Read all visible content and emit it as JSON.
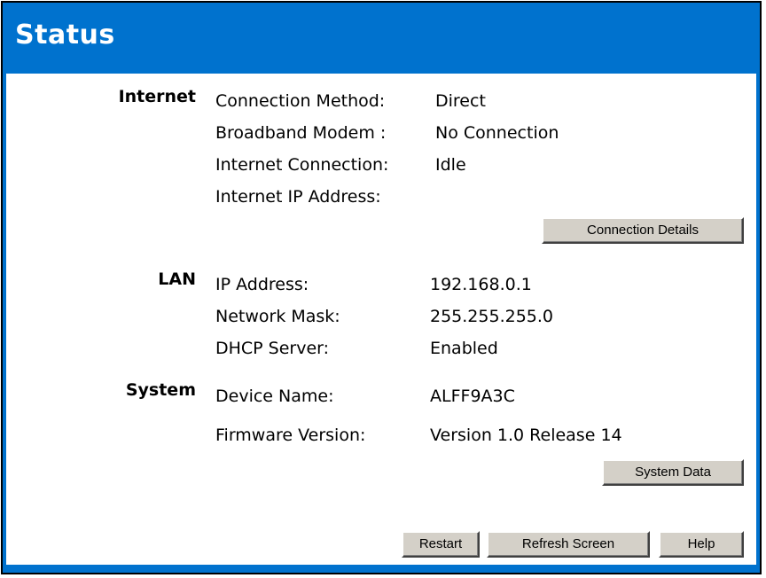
{
  "header": {
    "title": "Status"
  },
  "internet": {
    "title": "Internet",
    "rows": [
      {
        "label": "Connection Method:",
        "value": "Direct"
      },
      {
        "label": "Broadband Modem :",
        "value": "No Connection"
      },
      {
        "label": "Internet Connection:",
        "value": "Idle"
      },
      {
        "label": "Internet IP Address:",
        "value": ""
      }
    ],
    "button_label": "Connection Details"
  },
  "lan": {
    "title": "LAN",
    "rows": [
      {
        "label": "IP Address:",
        "value": "192.168.0.1"
      },
      {
        "label": "Network Mask:",
        "value": "255.255.255.0"
      },
      {
        "label": "DHCP Server:",
        "value": "Enabled"
      }
    ]
  },
  "system": {
    "title": "System",
    "rows": [
      {
        "label": "Device Name:",
        "value": "ALFF9A3C"
      },
      {
        "label": "Firmware Version:",
        "value": "Version 1.0 Release 14"
      }
    ],
    "button_label": "System Data"
  },
  "footer": {
    "restart_label": "Restart",
    "refresh_label": "Refresh Screen",
    "help_label": "Help"
  },
  "colors": {
    "accent": "#0072ce",
    "button_face": "#d4d0c8"
  }
}
